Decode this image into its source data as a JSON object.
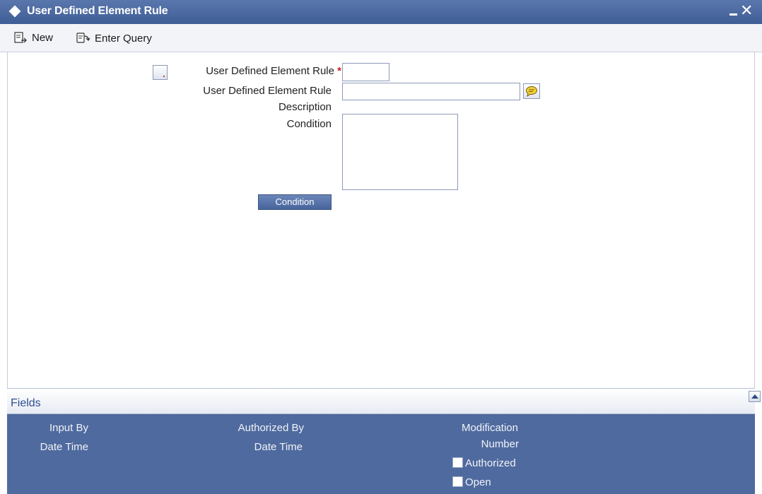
{
  "window": {
    "title": "User Defined Element Rule"
  },
  "toolbar": {
    "new_label": "New",
    "enter_query_label": "Enter Query"
  },
  "form": {
    "rule_label": "User Defined Element Rule",
    "required_marker": "*",
    "rule_value": "",
    "desc_label_line1": "User Defined Element Rule",
    "desc_label_line2": "Description",
    "desc_value": "",
    "condition_label": "Condition",
    "condition_value": "",
    "condition_button_label": "Condition"
  },
  "fields_bar": {
    "label": "Fields"
  },
  "audit": {
    "input_by_label": "Input By",
    "input_date_time_label": "Date Time",
    "authorized_by_label": "Authorized By",
    "authorized_date_time_label": "Date Time",
    "modification_label_line1": "Modification",
    "modification_label_line2": "Number",
    "authorized_check_label": "Authorized",
    "open_check_label": "Open"
  },
  "colors": {
    "titlebar": "#3f5d96",
    "footer": "#4f6a9e",
    "required": "#d0191b",
    "fields_text": "#2d4f8f"
  },
  "icons": {
    "window": "diamond-icon",
    "new": "new-document-icon",
    "enter_query": "query-icon",
    "lov": "speech-bubble-icon",
    "minimize": "minimize-icon",
    "close": "close-icon",
    "expand": "arrow-up-icon"
  }
}
